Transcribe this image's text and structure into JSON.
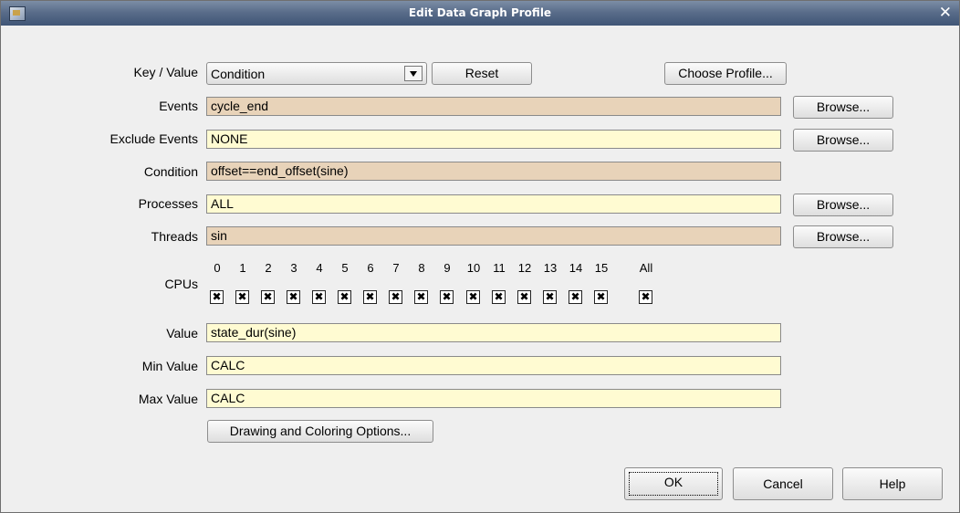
{
  "window": {
    "title": "Edit Data Graph Profile"
  },
  "key_value": {
    "label": "Key / Value",
    "selected": "Condition",
    "reset_label": "Reset",
    "choose_profile_label": "Choose Profile..."
  },
  "events": {
    "label": "Events",
    "value": "cycle_end",
    "browse_label": "Browse..."
  },
  "exclude_events": {
    "label": "Exclude Events",
    "value": "NONE",
    "browse_label": "Browse..."
  },
  "condition": {
    "label": "Condition",
    "value": "offset==end_offset(sine)"
  },
  "processes": {
    "label": "Processes",
    "value": "ALL",
    "browse_label": "Browse..."
  },
  "threads": {
    "label": "Threads",
    "value": "sin",
    "browse_label": "Browse..."
  },
  "cpus": {
    "label": "CPUs",
    "items": [
      {
        "num": "0",
        "checked": "✖"
      },
      {
        "num": "1",
        "checked": "✖"
      },
      {
        "num": "2",
        "checked": "✖"
      },
      {
        "num": "3",
        "checked": "✖"
      },
      {
        "num": "4",
        "checked": "✖"
      },
      {
        "num": "5",
        "checked": "✖"
      },
      {
        "num": "6",
        "checked": "✖"
      },
      {
        "num": "7",
        "checked": "✖"
      },
      {
        "num": "8",
        "checked": "✖"
      },
      {
        "num": "9",
        "checked": "✖"
      },
      {
        "num": "10",
        "checked": "✖"
      },
      {
        "num": "11",
        "checked": "✖"
      },
      {
        "num": "12",
        "checked": "✖"
      },
      {
        "num": "13",
        "checked": "✖"
      },
      {
        "num": "14",
        "checked": "✖"
      },
      {
        "num": "15",
        "checked": "✖"
      }
    ],
    "all": {
      "num": "All",
      "checked": "✖"
    }
  },
  "value": {
    "label": "Value",
    "value": "state_dur(sine)"
  },
  "min_value": {
    "label": "Min Value",
    "value": "CALC"
  },
  "max_value": {
    "label": "Max Value",
    "value": "CALC"
  },
  "drawing_options_label": "Drawing and Coloring Options...",
  "footer": {
    "ok_label": "OK",
    "cancel_label": "Cancel",
    "help_label": "Help"
  },
  "colors": {
    "required_field": "#e8d3b9",
    "optional_field": "#fffbd2",
    "titlebar": "#4f6382"
  }
}
